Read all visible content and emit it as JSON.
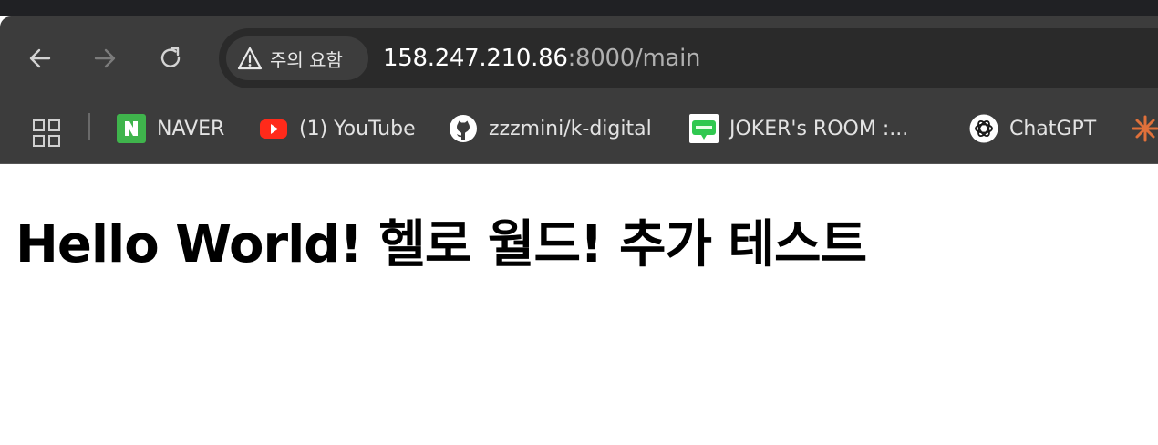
{
  "browser": {
    "security_label": "주의 요함",
    "url_host": "158.247.210.86",
    "url_rest": ":8000/main",
    "colors": {
      "frame": "#3c3c3c",
      "omnibox": "#2a2a2a",
      "chip": "#3d3d3d"
    }
  },
  "bookmarks": [
    {
      "label": "NAVER",
      "icon": "naver-icon"
    },
    {
      "label": "(1) YouTube",
      "icon": "youtube-icon"
    },
    {
      "label": "zzzmini/k-digital",
      "icon": "github-icon"
    },
    {
      "label": "JOKER's ROOM :...",
      "icon": "blog-icon"
    },
    {
      "label": "ChatGPT",
      "icon": "chatgpt-icon"
    }
  ],
  "page": {
    "heading": "Hello World! 헬로 월드! 추가 테스트"
  }
}
